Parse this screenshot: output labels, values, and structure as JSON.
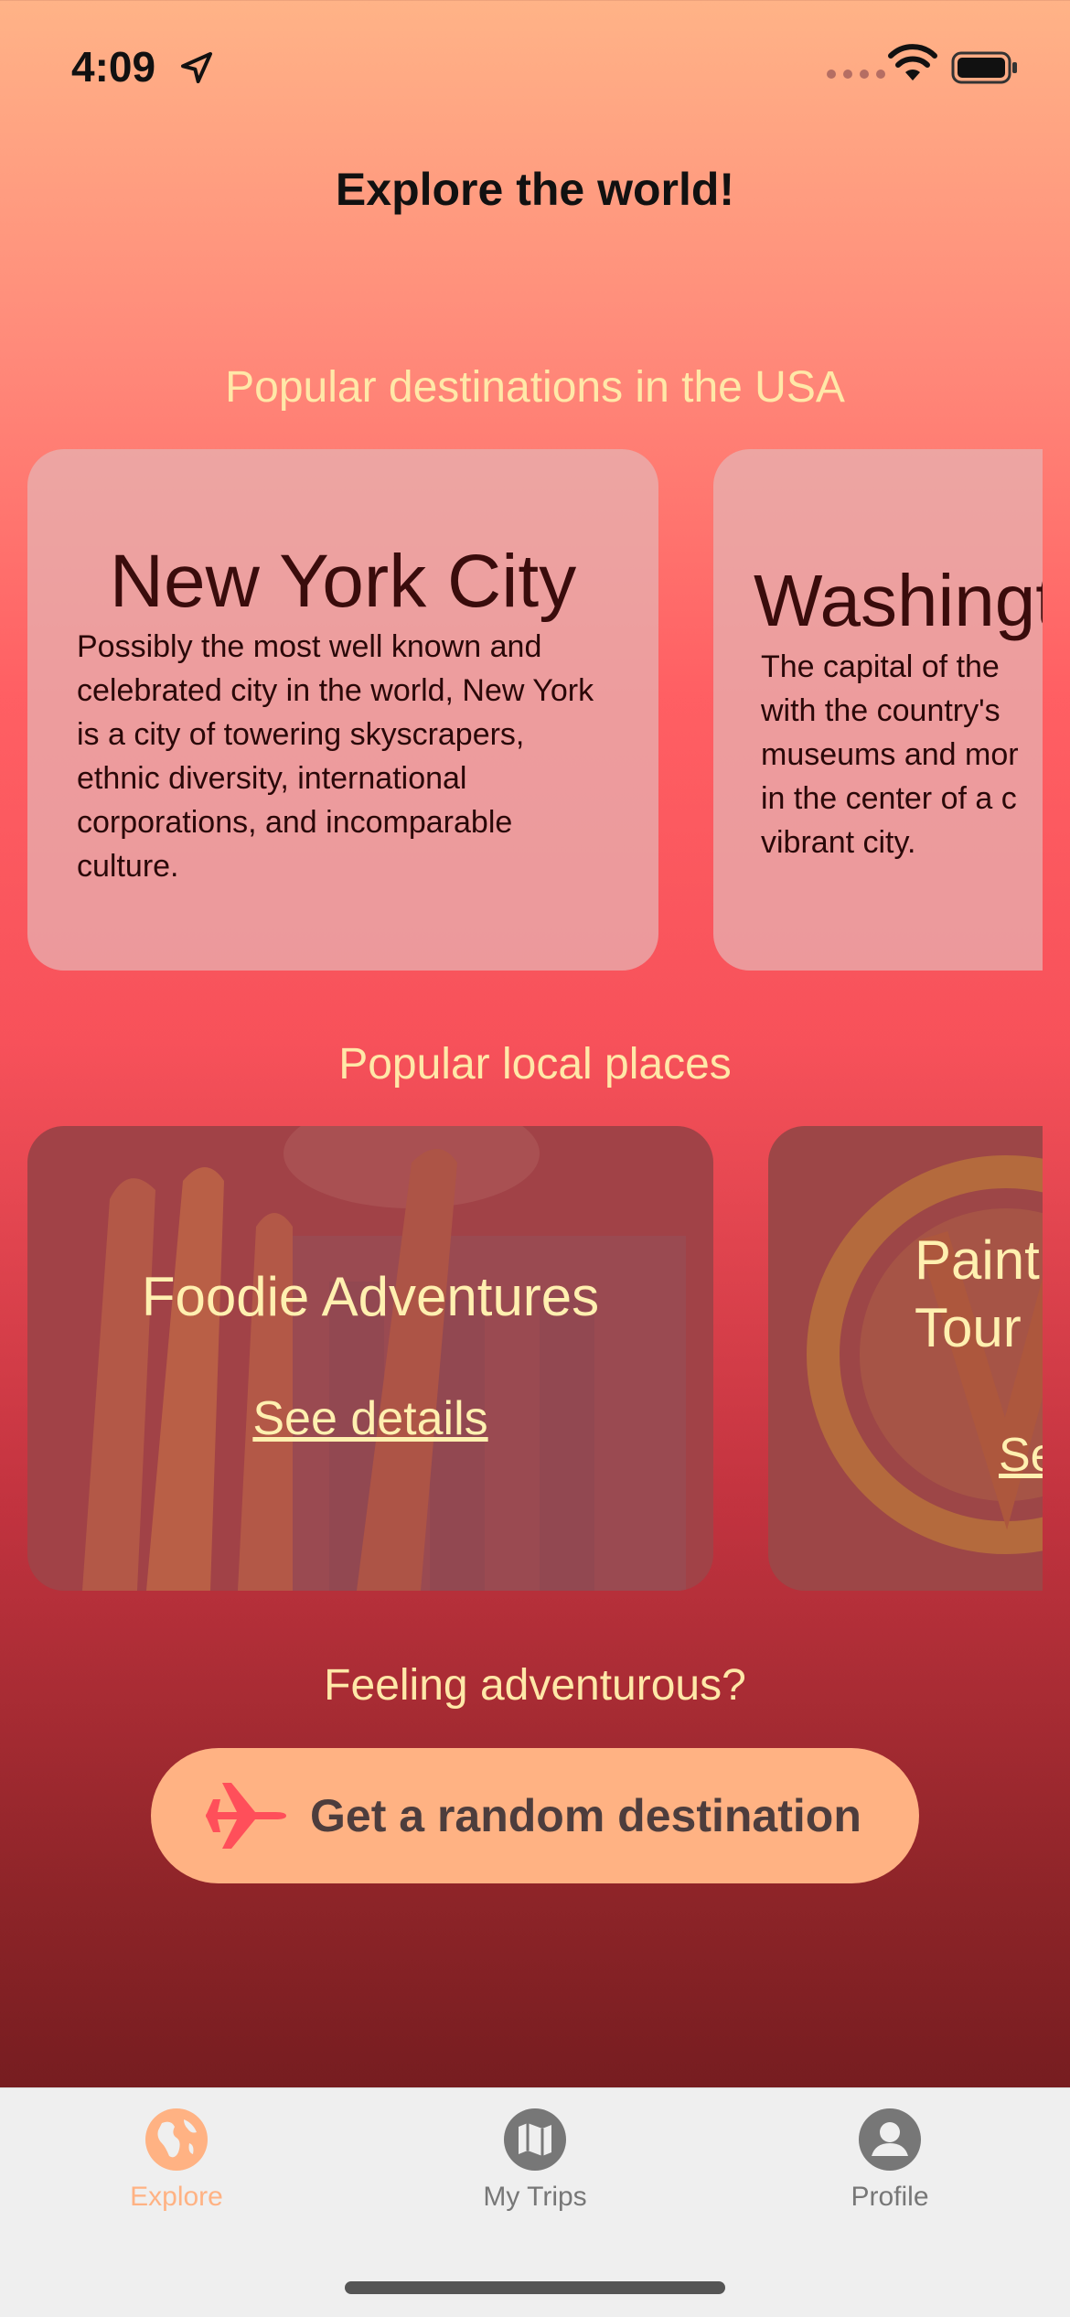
{
  "status_bar": {
    "time": "4:09"
  },
  "header": {
    "title": "Explore the world!"
  },
  "sections": {
    "destinations_title": "Popular destinations in the USA",
    "local_title": "Popular local places",
    "adventure_title": "Feeling adventurous?"
  },
  "destinations": [
    {
      "name": "New York City",
      "description": "Possibly the most well known and celebrated city in the world, New York is a city of towering skyscrapers, ethnic diversity, international corporations, and incomparable culture."
    },
    {
      "name": "Washingt",
      "description": "The capital of the with the country's museums and mor in the center of a c vibrant city."
    }
  ],
  "local_places": [
    {
      "name": "Foodie Adventures",
      "link": "See details"
    },
    {
      "name": "Paint Tour",
      "link": "Se"
    }
  ],
  "random_button": {
    "label": "Get a random destination"
  },
  "tabs": [
    {
      "label": "Explore",
      "icon": "globe-icon",
      "active": true
    },
    {
      "label": "My Trips",
      "icon": "map-icon",
      "active": false
    },
    {
      "label": "Profile",
      "icon": "person-icon",
      "active": false
    }
  ],
  "colors": {
    "accent": "#ffb283",
    "section_text": "#ffe8a8",
    "tab_active": "#ffb283",
    "tab_inactive": "#777777"
  }
}
